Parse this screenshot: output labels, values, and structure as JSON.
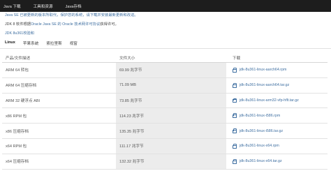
{
  "topnav": {
    "items": [
      "Java 下载",
      "工具和资源",
      "Java存档"
    ]
  },
  "intro": {
    "line1": "Java SE 已被更新的版本所取代，保护您的系统，请下载并安装最新更新和改进。",
    "line2_prefix": "JDK 8 软件根据",
    "line2_link": "Oracle Java SE 的 Oracle 技术网许可协议",
    "line2_suffix": "获得许可。",
    "link3": "JDK 8u361校验和"
  },
  "tabs": [
    "Linux",
    "苹果系统",
    "索拉里斯",
    "视窗"
  ],
  "table": {
    "headers": [
      "产品/文件描述",
      "文件大小",
      "下载"
    ],
    "rows": [
      {
        "desc": "ARM 64 转包",
        "size": "69.99 兆字节",
        "file": "jdk-8u361-linux-aarch64.rpm"
      },
      {
        "desc": "ARM 64 压缩存档",
        "size": "71.09 MB",
        "file": "jdk-8u361-linux-aarch64.tar.gz"
      },
      {
        "desc": "ARM 32 硬浮点 ABI",
        "size": "73.85 兆字节",
        "file": "jdk-8u361-linux-arm32-vfp-hflt.tar.gz"
      },
      {
        "desc": "x86 RPM 包",
        "size": "114.23 兆字节",
        "file": "jdk-8u361-linux-i586.rpm"
      },
      {
        "desc": "x86 压缩存档",
        "size": "135.35 兆字节",
        "file": "jdk-8u361-linux-i586.tar.gz"
      },
      {
        "desc": "x64 RPM 包",
        "size": "111.17 兆字节",
        "file": "jdk-8u361-linux-x64.rpm"
      },
      {
        "desc": "x64 压缩存档",
        "size": "132.32 兆字节",
        "file": "jdk-8u361-linux-x64.tar.gz"
      }
    ]
  }
}
